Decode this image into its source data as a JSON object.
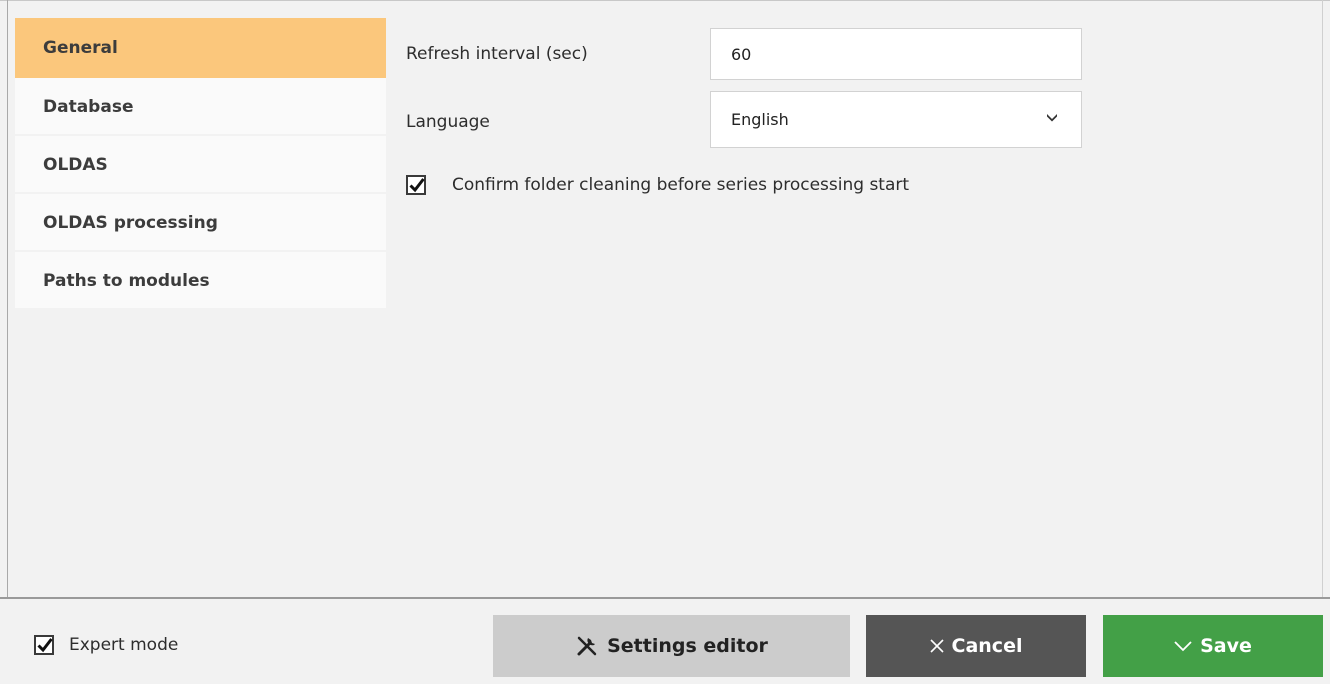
{
  "sidebar": {
    "items": [
      {
        "label": "General",
        "active": true
      },
      {
        "label": "Database"
      },
      {
        "label": "OLDAS"
      },
      {
        "label": "OLDAS processing"
      },
      {
        "label": "Paths to modules"
      }
    ]
  },
  "form": {
    "refresh_label": "Refresh interval (sec)",
    "refresh_value": "60",
    "language_label": "Language",
    "language_value": "English",
    "confirm_label": "Confirm folder cleaning before series processing start",
    "confirm_checked": true
  },
  "footer": {
    "expert_label": "Expert mode",
    "expert_checked": true,
    "settings_editor_label": "Settings editor",
    "cancel_label": "Cancel",
    "save_label": "Save"
  },
  "colors": {
    "active_tab": "#fbc77c",
    "cancel_bg": "#555555",
    "save_bg": "#43a047",
    "settings_bg": "#cccccc"
  },
  "icons": {
    "settings_editor": "tools-icon",
    "cancel": "close-icon",
    "save": "check-icon",
    "language_dropdown": "chevron-down-icon"
  }
}
